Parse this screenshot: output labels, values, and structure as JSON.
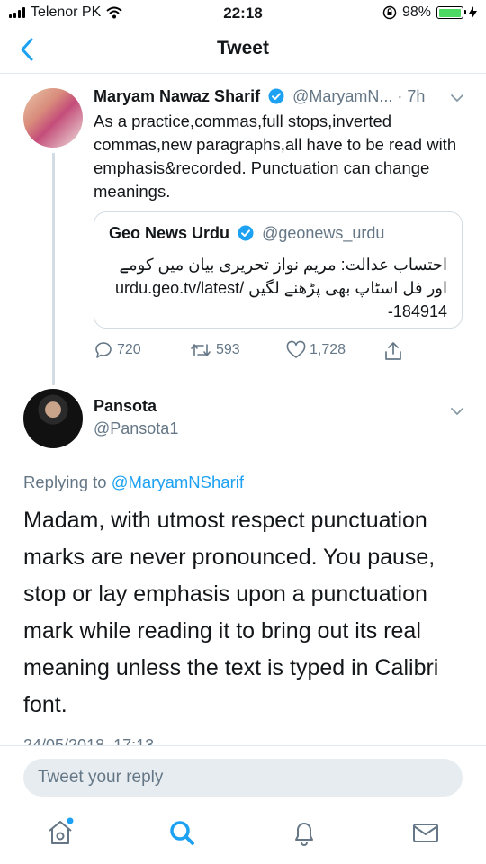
{
  "status_bar": {
    "carrier": "Telenor PK",
    "time": "22:18",
    "battery": "98%",
    "battery_level": 0.98
  },
  "nav": {
    "title": "Tweet"
  },
  "tweet": {
    "name": "Maryam Nawaz Sharif",
    "handle": "@MaryamN...",
    "time": "· 7h",
    "text": "As a practice,commas,full stops,inverted commas,new paragraphs,all have to be read with emphasis&recorded. Punctuation can change meanings.",
    "quote": {
      "name": "Geo News Urdu",
      "handle": "@geonews_urdu",
      "text": "احتساب عدالت: مریم نواز تحریری بیان میں کومے اور فل اسٹاپ بھی پڑھنے لگیں /urdu.geo.tv/latest 184914-"
    },
    "actions": {
      "replies": "720",
      "retweets": "593",
      "likes": "1,728"
    }
  },
  "reply": {
    "name": "Pansota",
    "handle": "@Pansota1",
    "replying_prefix": "Replying to ",
    "replying_to": "@MaryamNSharif",
    "text": "Madam, with utmost respect punctuation marks are never pronounced. You pause, stop or lay emphasis upon a punctuation mark while reading it to bring out its real meaning unless the text is typed in Calibri font.",
    "date": "24/05/2018, 17:13"
  },
  "compose": {
    "placeholder": "Tweet your reply"
  },
  "tabbar": {
    "items": [
      "home-icon",
      "search-icon",
      "bell-icon",
      "mail-icon"
    ],
    "active": "search-icon"
  },
  "colors": {
    "accent": "#1da1f2",
    "muted": "#657786",
    "battery": "#4cd964"
  }
}
